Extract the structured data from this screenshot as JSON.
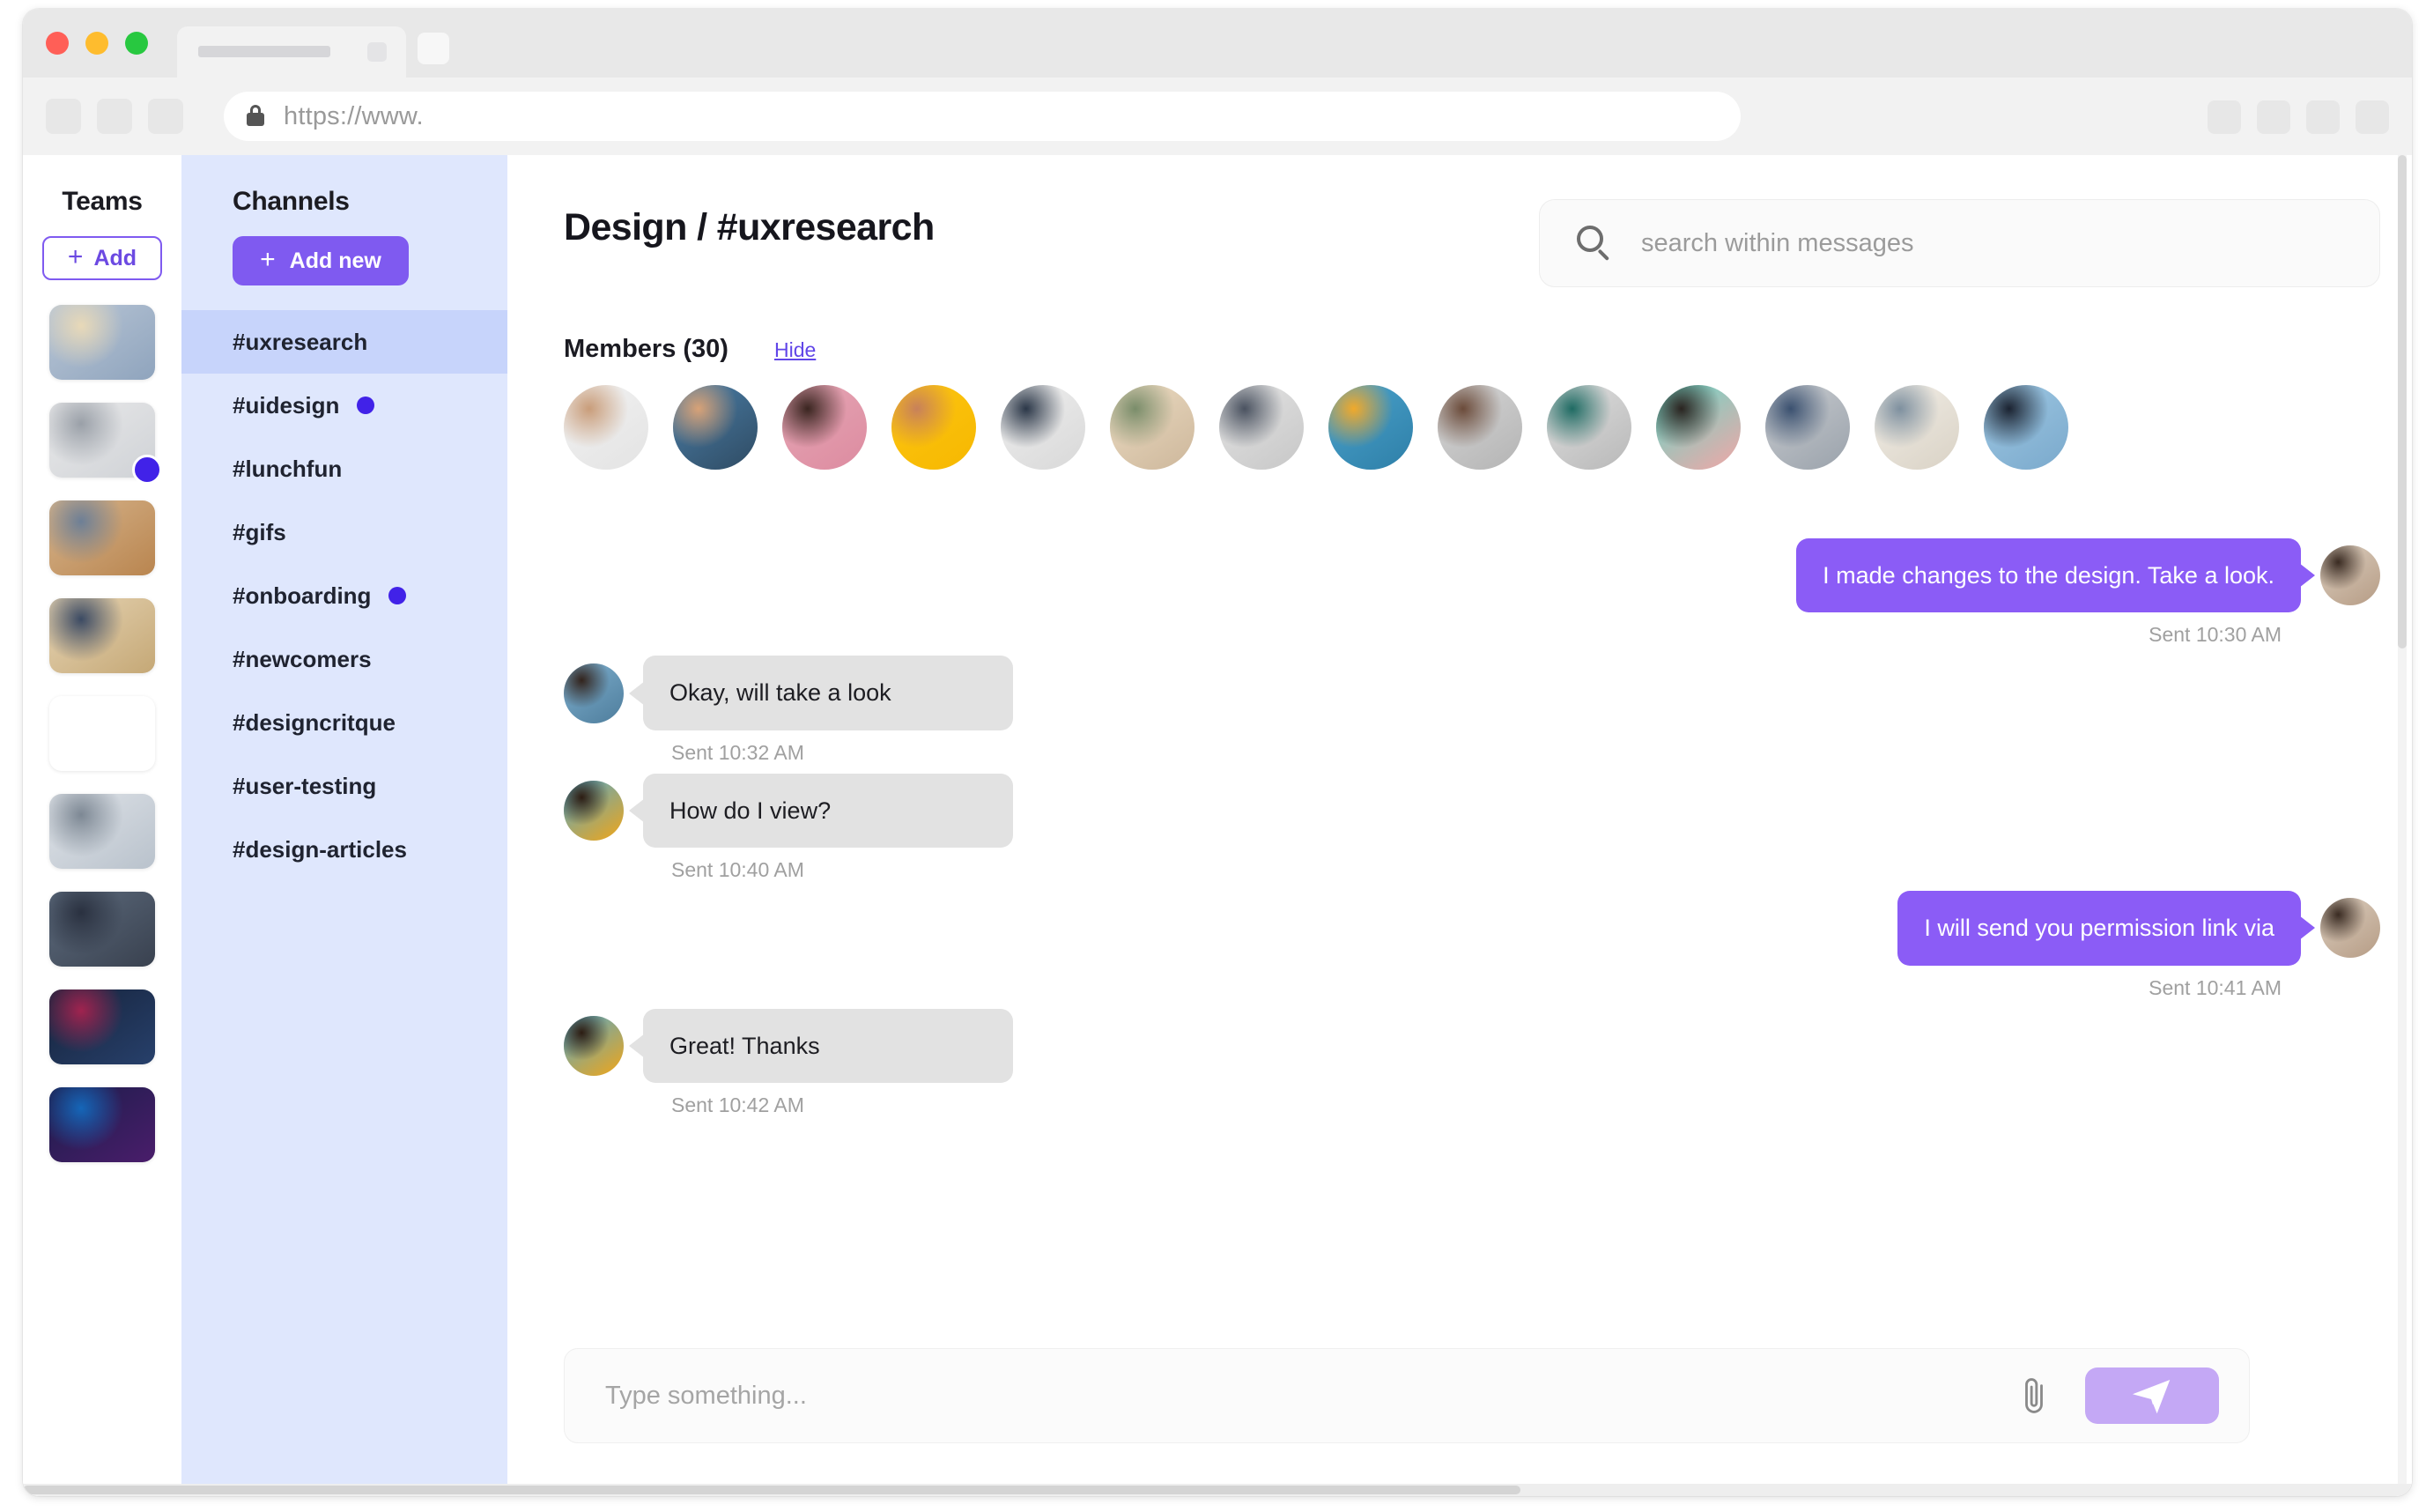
{
  "browser": {
    "url_text": "https://www.",
    "lock_icon": "lock-icon",
    "tab_new_icon": "new-tab-icon",
    "nav_buttons": [
      "back-button",
      "forward-button",
      "reload-button"
    ],
    "right_buttons": [
      "extension-button-1",
      "extension-button-2",
      "extension-button-3",
      "profile-button"
    ]
  },
  "teams": {
    "title": "Teams",
    "add_label": "Add",
    "add_icon": "plus-icon",
    "items": [
      {
        "name": "team-1",
        "active": true,
        "badge": false,
        "colors": [
          "#b9c6d6",
          "#8fa4bd",
          "#e8d9b8"
        ]
      },
      {
        "name": "team-2",
        "active": false,
        "badge": true,
        "colors": [
          "#e9e9ea",
          "#cfd2d6",
          "#9aa0a8"
        ]
      },
      {
        "name": "team-3",
        "active": false,
        "badge": false,
        "colors": [
          "#d6b48c",
          "#b9854f",
          "#6d7f96"
        ]
      },
      {
        "name": "team-4",
        "active": false,
        "badge": false,
        "colors": [
          "#e6d4b4",
          "#c5a876",
          "#3b4a63"
        ]
      },
      {
        "name": "team-5",
        "active": false,
        "badge": false,
        "colors": [
          "#efe7dc",
          "#d3c8b8",
          "#8e8madd"
        ]
      },
      {
        "name": "team-6",
        "active": false,
        "badge": false,
        "colors": [
          "#dfe3e8",
          "#b9c2cc",
          "#7d8894"
        ]
      },
      {
        "name": "team-7",
        "active": false,
        "badge": false,
        "colors": [
          "#5d6b7d",
          "#39414f",
          "#2a3140"
        ]
      },
      {
        "name": "team-8",
        "active": false,
        "badge": false,
        "colors": [
          "#16233b",
          "#27406b",
          "#a0234f"
        ]
      },
      {
        "name": "team-9",
        "active": false,
        "badge": false,
        "colors": [
          "#1b1d4a",
          "#4a1d6b",
          "#1566b8"
        ]
      }
    ]
  },
  "channels": {
    "title": "Channels",
    "add_label": "Add new",
    "add_icon": "plus-icon",
    "items": [
      {
        "label": "#uxresearch",
        "active": true,
        "unread": false
      },
      {
        "label": "#uidesign",
        "active": false,
        "unread": true
      },
      {
        "label": "#lunchfun",
        "active": false,
        "unread": false
      },
      {
        "label": "#gifs",
        "active": false,
        "unread": false
      },
      {
        "label": "#onboarding",
        "active": false,
        "unread": true
      },
      {
        "label": "#newcomers",
        "active": false,
        "unread": false
      },
      {
        "label": "#designcritque",
        "active": false,
        "unread": false
      },
      {
        "label": "#user-testing",
        "active": false,
        "unread": false
      },
      {
        "label": "#design-articles",
        "active": false,
        "unread": false
      }
    ]
  },
  "chat": {
    "title": "Design / #uxresearch",
    "search": {
      "placeholder": "search within messages",
      "value": "",
      "icon": "search-icon"
    },
    "members": {
      "label": "Members (30)",
      "count": 30,
      "hide_label": "Hide",
      "avatars": [
        {
          "name": "member-avatar-1",
          "colors": [
            "#f2f2f2",
            "#e3e3e3",
            "#c99d7a"
          ]
        },
        {
          "name": "member-avatar-2",
          "colors": [
            "#4b7fa8",
            "#2f4b63",
            "#d8a277"
          ]
        },
        {
          "name": "member-avatar-3",
          "colors": [
            "#e5a7b5",
            "#dd8ba0",
            "#3a2520"
          ]
        },
        {
          "name": "member-avatar-4",
          "colors": [
            "#fdc512",
            "#f6b800",
            "#c8815a"
          ]
        },
        {
          "name": "member-avatar-5",
          "colors": [
            "#efefef",
            "#d8d8d8",
            "#2b3748"
          ]
        },
        {
          "name": "member-avatar-6",
          "colors": [
            "#ecdcc3",
            "#cdb79b",
            "#7a8d6a"
          ]
        },
        {
          "name": "member-avatar-7",
          "colors": [
            "#e4e4e4",
            "#c7c7c7",
            "#4a5260"
          ]
        },
        {
          "name": "member-avatar-8",
          "colors": [
            "#4ba3cc",
            "#2e7fa8",
            "#f0a92b"
          ]
        },
        {
          "name": "member-avatar-9",
          "colors": [
            "#d6d6d6",
            "#b4b4b4",
            "#6b4b3a"
          ]
        },
        {
          "name": "member-avatar-10",
          "colors": [
            "#e0e0e0",
            "#b8b8b8",
            "#1f6b63"
          ]
        },
        {
          "name": "member-avatar-11",
          "colors": [
            "#63d8c8",
            "#f2a6a6",
            "#2a2420"
          ]
        },
        {
          "name": "member-avatar-12",
          "colors": [
            "#c9ccd0",
            "#9aa2ab",
            "#3b5170"
          ]
        },
        {
          "name": "member-avatar-13",
          "colors": [
            "#f2eee7",
            "#d9d2c5",
            "#7e909f"
          ]
        },
        {
          "name": "member-avatar-14",
          "colors": [
            "#9fc8e3",
            "#7aa9cc",
            "#1b2331"
          ]
        }
      ]
    },
    "messages": [
      {
        "id": "msg-1",
        "side": "out",
        "text": "I made changes to the design. Take a look.",
        "timestamp": "Sent 10:30 AM",
        "avatar": {
          "name": "sender-avatar",
          "colors": [
            "#dccfc0",
            "#b69c85",
            "#3a2b22"
          ]
        }
      },
      {
        "id": "msg-2",
        "side": "in",
        "text": "Okay, will take a look",
        "timestamp": "Sent 10:32 AM",
        "avatar": {
          "name": "sender-avatar",
          "colors": [
            "#7fb0cf",
            "#4e7d9c",
            "#32231c"
          ]
        }
      },
      {
        "id": "msg-3",
        "side": "in",
        "text": "How do I view?",
        "timestamp": "Sent 10:40 AM",
        "avatar": {
          "name": "sender-avatar",
          "colors": [
            "#4fa8cf",
            "#f2a616",
            "#2c1c12"
          ]
        }
      },
      {
        "id": "msg-4",
        "side": "out",
        "text": "I will send you permission link via",
        "timestamp": "Sent 10:41 AM",
        "avatar": {
          "name": "sender-avatar",
          "colors": [
            "#dccfc0",
            "#b69c85",
            "#3a2b22"
          ]
        }
      },
      {
        "id": "msg-5",
        "side": "in",
        "text": "Great! Thanks",
        "timestamp": "Sent 10:42 AM",
        "avatar": {
          "name": "sender-avatar",
          "colors": [
            "#4fa8cf",
            "#f2a616",
            "#2c1c12"
          ]
        }
      }
    ],
    "composer": {
      "placeholder": "Type something...",
      "value": "",
      "attach_icon": "paperclip-icon",
      "send_icon": "send-plane-icon"
    }
  },
  "colors": {
    "accent_purple": "#7f5af0",
    "bubble_out": "#8b5cf6",
    "bubble_in": "#e2e2e2",
    "send_button": "#c4a8f5",
    "channels_bg": "#dfe7fd",
    "channel_active_bg": "#c7d4fb",
    "unread_dot": "#4122e8",
    "link": "#6146e8"
  }
}
